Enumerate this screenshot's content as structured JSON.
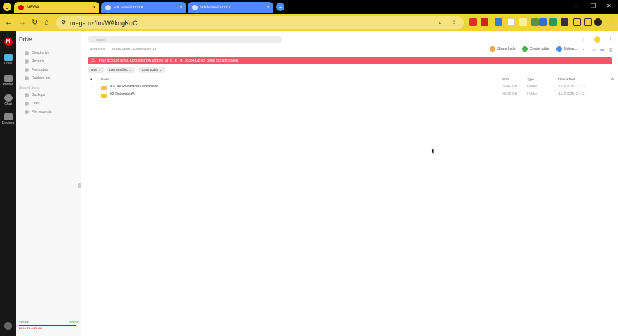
{
  "browser": {
    "tabs": [
      {
        "title": "MEGA",
        "active": true
      },
      {
        "title": "sm.lanaalo.com",
        "active": false
      },
      {
        "title": "sm.lanaalo.com",
        "active": false
      }
    ],
    "url": "mega.nz/fm/WAkngKqC"
  },
  "rail": {
    "items": [
      "Drive",
      "Photos",
      "Chat",
      "Devices"
    ]
  },
  "sidebar": {
    "title": "Drive",
    "nav": [
      "Cloud drive",
      "Recents",
      "Favourites",
      "Rubbish bin",
      "Backups",
      "Links",
      "File requests"
    ],
    "section_label": "Shared items",
    "storage_label": "Storage",
    "storage_value": "22.01 TB of 20 GB",
    "upgrade": "Upgrade"
  },
  "main": {
    "search_placeholder": "Search",
    "breadcrumb": [
      "Cloud drive",
      "Frank Mem - Rainmakers AI"
    ],
    "actions": {
      "share": "Share folder",
      "create": "Create folder",
      "upload": "Upload..."
    },
    "banner": "Your account is full. Upgrade now and get up to 16 TB (16384 GB) of cloud storage space.",
    "filters": [
      "Type",
      "Last modified",
      "Date added"
    ],
    "columns": {
      "name": "Name",
      "size": "Size",
      "type": "Type",
      "date": "Date added"
    },
    "rows": [
      {
        "name": "01-The Rainmaker Certification",
        "size": "30.42 GB",
        "type": "Folder",
        "date": "15/7/2025, 21:13"
      },
      {
        "name": "02-RainmakerAI",
        "size": "46.09 GB",
        "type": "Folder",
        "date": "15/7/2025, 21:13"
      }
    ]
  },
  "colors": {
    "accent": "#d90007",
    "toolbar": "#f2d33e",
    "banner": "#f0586a"
  }
}
